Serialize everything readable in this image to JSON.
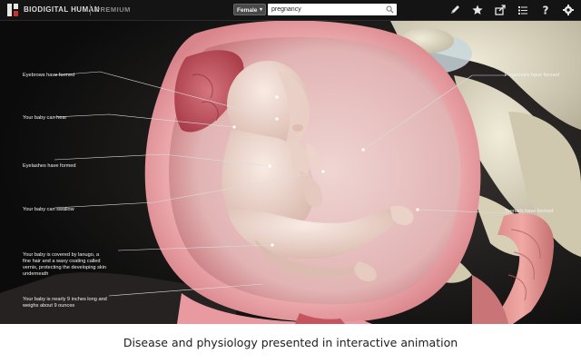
{
  "app": {
    "brand": "BIODIGITAL HUMAN",
    "tier": "PREMIUM"
  },
  "toolbar": {
    "sex_select": "Female",
    "search_value": "pregnancy",
    "icons": [
      "pencil-icon",
      "star-icon",
      "share-icon",
      "checklist-icon",
      "help-icon",
      "settings-icon"
    ]
  },
  "annotations": [
    "Eyebrows have formed",
    "Your baby can hear",
    "Eyelashes have formed",
    "Your baby can swallow",
    "Your baby is covered by lanugo, a",
    "fine hair and a waxy coating called",
    "vernix, protecting the developing skin",
    "underneath",
    "Your baby is nearly 9 inches long and",
    "weighs about 9 ounces",
    "Fingernails have formed",
    "Toenails have formed"
  ],
  "caption": "Disease and physiology presented in interactive animation",
  "colors": {
    "toolbar_bg": "#141414",
    "viewport_bg": "#0b0b0b",
    "tissue_pink": "#e9a3a6",
    "fetus_skin": "#f0d8d0",
    "bone": "#ded7c0",
    "brand_red": "#c9342e"
  }
}
